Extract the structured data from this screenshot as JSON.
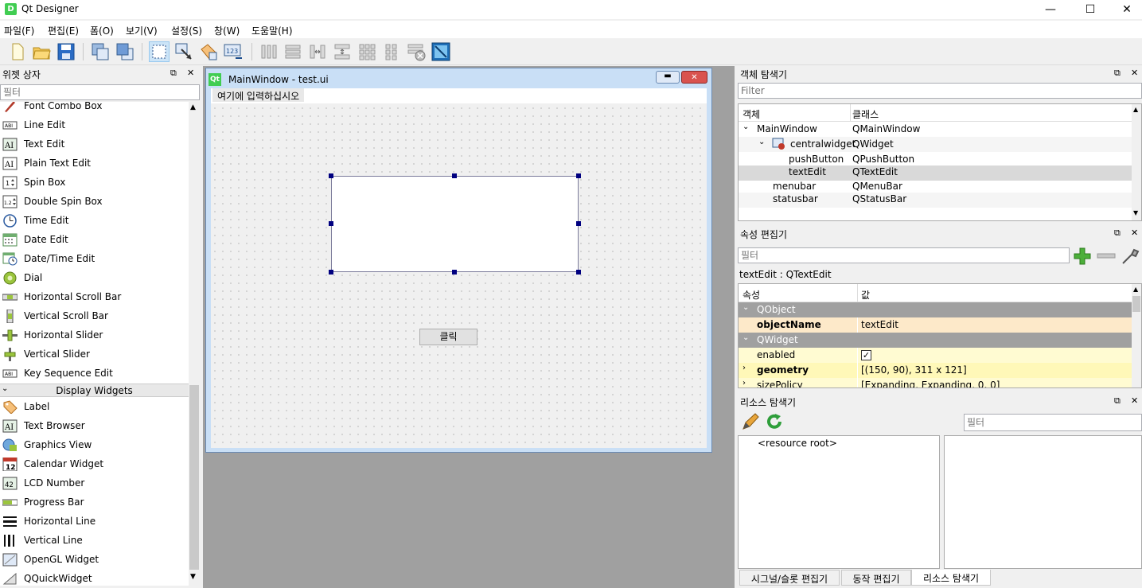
{
  "app": {
    "title": "Qt Designer",
    "icon_label": "D"
  },
  "window_controls": {
    "minimize": "—",
    "maximize": "☐",
    "close": "✕"
  },
  "menu": [
    "파일(F)",
    "편집(E)",
    "폼(O)",
    "보기(V)",
    "설정(S)",
    "창(W)",
    "도움말(H)"
  ],
  "toolbar": {
    "icons": [
      "new-file-icon",
      "open-folder-icon",
      "save-icon",
      "send-to-back-icon",
      "bring-to-front-icon",
      "edit-widgets-icon",
      "edit-signals-slots-icon",
      "edit-buddies-icon",
      "edit-tab-order-icon",
      "layout-horizontal-icon",
      "layout-vertical-icon",
      "layout-h-splitter-icon",
      "layout-v-splitter-icon",
      "layout-grid-icon",
      "layout-form-icon",
      "break-layout-icon",
      "adjust-size-icon"
    ]
  },
  "widget_box": {
    "title": "위젯 상자",
    "filter_placeholder": "필터",
    "items_top": [
      "Font Combo Box",
      "Line Edit",
      "Text Edit",
      "Plain Text Edit",
      "Spin Box",
      "Double Spin Box",
      "Time Edit",
      "Date Edit",
      "Date/Time Edit",
      "Dial",
      "Horizontal Scroll Bar",
      "Vertical Scroll Bar",
      "Horizontal Slider",
      "Vertical Slider",
      "Key Sequence Edit"
    ],
    "category": "Display Widgets",
    "items_display": [
      "Label",
      "Text Browser",
      "Graphics View",
      "Calendar Widget",
      "LCD Number",
      "Progress Bar",
      "Horizontal Line",
      "Vertical Line",
      "OpenGL Widget",
      "QQuickWidget"
    ]
  },
  "form": {
    "title": "MainWindow - test.ui",
    "menu_placeholder": "여기에 입력하십시오",
    "button_label": "클릭"
  },
  "object_inspector": {
    "title": "객체 탐색기",
    "filter_placeholder": "Filter",
    "col_object": "객체",
    "col_class": "클래스",
    "rows": [
      {
        "name": "MainWindow",
        "cls": "QMainWindow"
      },
      {
        "name": "centralwidget",
        "cls": "QWidget"
      },
      {
        "name": "pushButton",
        "cls": "QPushButton"
      },
      {
        "name": "textEdit",
        "cls": "QTextEdit"
      },
      {
        "name": "menubar",
        "cls": "QMenuBar"
      },
      {
        "name": "statusbar",
        "cls": "QStatusBar"
      }
    ]
  },
  "property_editor": {
    "title": "속성 편집기",
    "filter_placeholder": "필터",
    "context": "textEdit : QTextEdit",
    "col_property": "속성",
    "col_value": "값",
    "group1": "QObject",
    "objectName_label": "objectName",
    "objectName_value": "textEdit",
    "group2": "QWidget",
    "enabled_label": "enabled",
    "enabled_checked": true,
    "geometry_label": "geometry",
    "geometry_value": "[(150, 90), 311 x 121]",
    "sizePolicy_label": "sizePolicy",
    "sizePolicy_value": "[Expanding, Expanding, 0, 0]"
  },
  "resource_browser": {
    "title": "리소스 탐색기",
    "filter_placeholder": "필터",
    "root": "<resource root>"
  },
  "bottom_tabs": [
    "시그널/슬롯 편집기",
    "동작 편집기",
    "리소스 탐색기"
  ]
}
